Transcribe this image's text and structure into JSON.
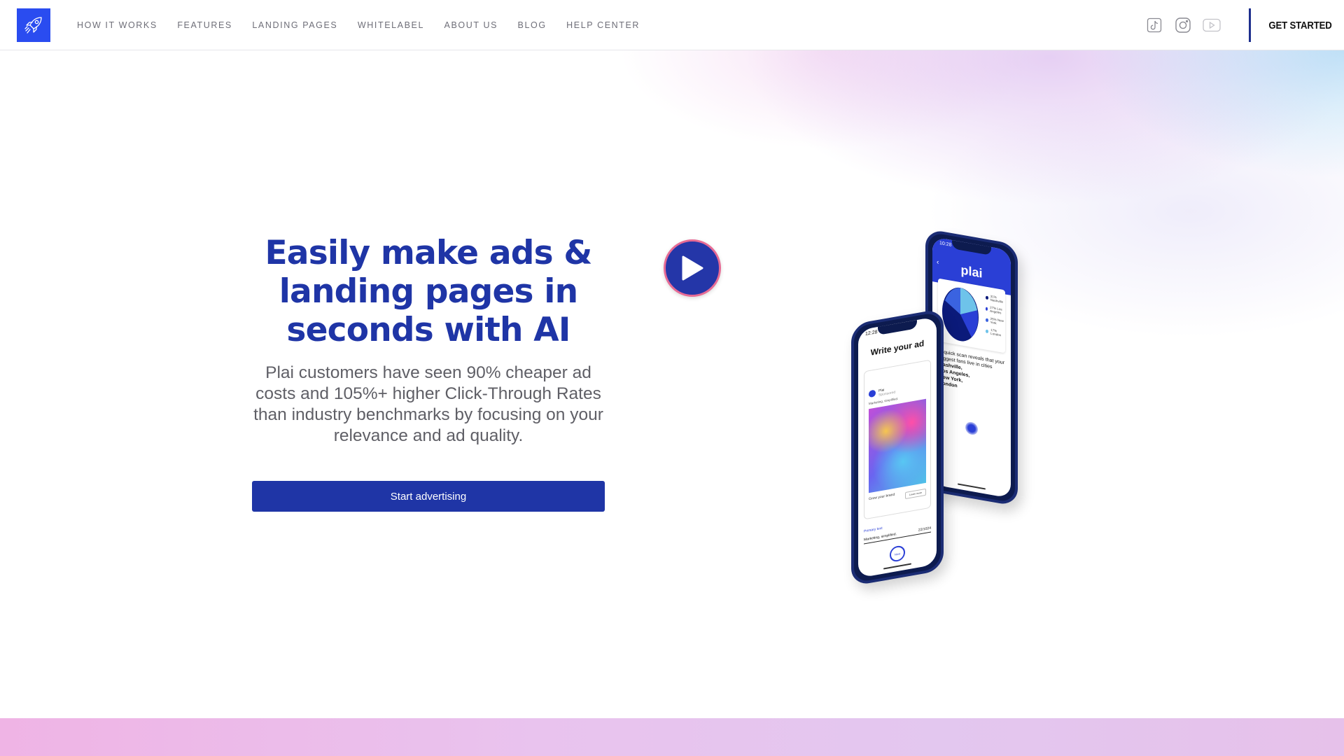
{
  "header": {
    "nav": [
      "HOW IT WORKS",
      "FEATURES",
      "LANDING PAGES",
      "WHITELABEL",
      "ABOUT US",
      "BLOG",
      "HELP CENTER"
    ],
    "social_icons": [
      "tiktok-icon",
      "instagram-icon",
      "youtube-icon"
    ],
    "cta_label": "GET STARTED"
  },
  "hero": {
    "headline": "Easily make ads & landing pages in seconds with AI",
    "subtext": "Plai customers have seen 90% cheaper ad costs and 105%+ higher Click-Through Rates than industry benchmarks by focusing on your relevance and ad quality.",
    "button_label": "Start advertising"
  },
  "phone_back": {
    "time": "10:28",
    "brand": "plai",
    "legend": [
      "31% Nashville",
      "27% Los Angeles",
      "25% New York",
      "17% London"
    ],
    "insight_intro": "A quick scan reveals that your biggest fans live in cities",
    "cities": [
      "Nashville,",
      "Los Angeles,",
      "New York,",
      "London"
    ]
  },
  "phone_front": {
    "time": "12:28",
    "title": "Write your ad",
    "page_name": "Plai",
    "page_sub": "Sponsored",
    "caption": "Marketing, simplified.",
    "ad_cta_text": "Grow your brand",
    "ad_cta_button": "Learn more",
    "primary_label": "Primary text",
    "primary_text": "Marketing, simplified.",
    "char_count": "22/1024",
    "next_label": "Next"
  },
  "colors": {
    "brand_blue": "#1f35a6",
    "logo_blue": "#2a4cf0",
    "play_ring": "#e76b95",
    "body_text": "#5f5f66"
  }
}
